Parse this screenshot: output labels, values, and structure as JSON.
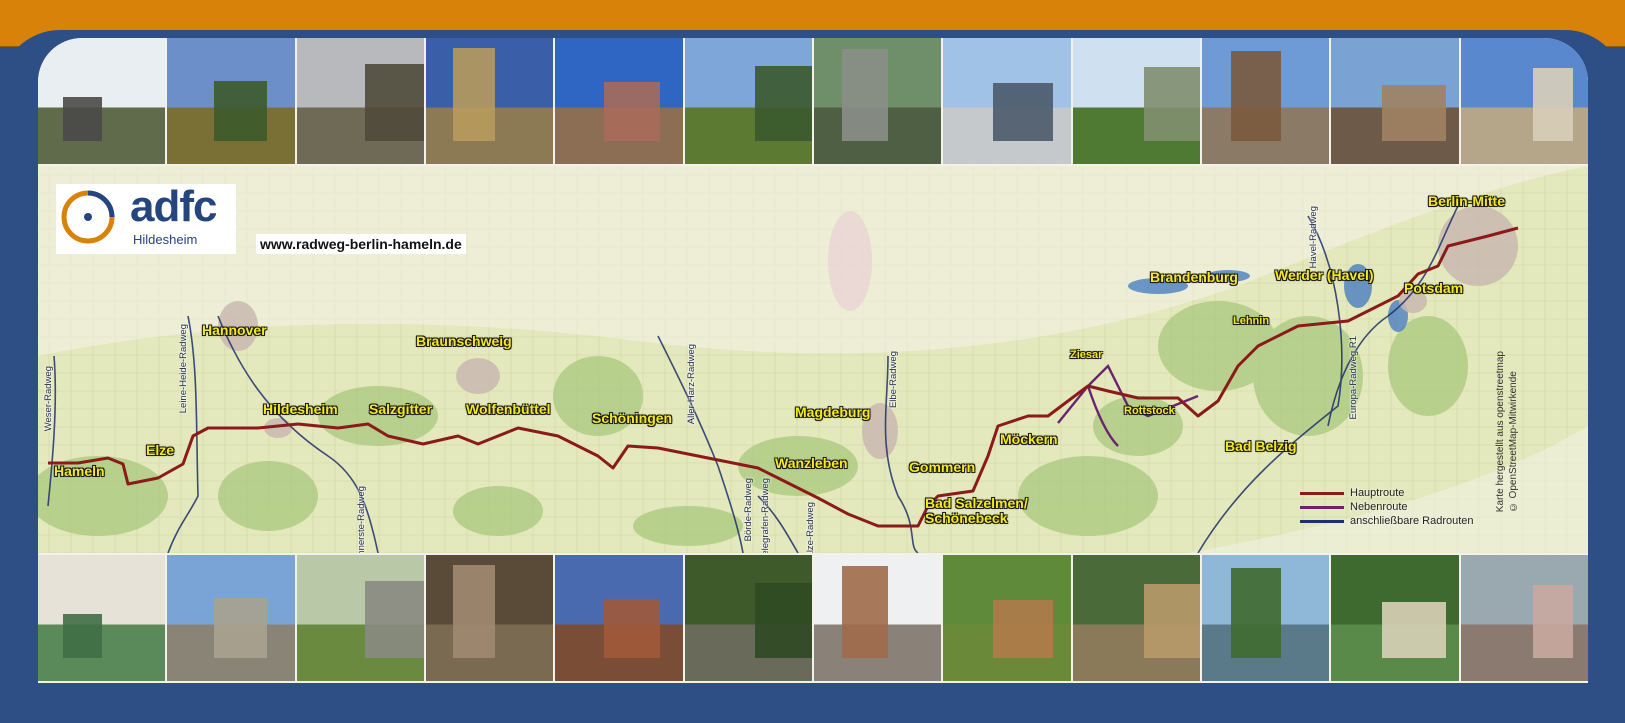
{
  "colors": {
    "frame_blue": "#2d4f86",
    "frame_orange": "#d98209",
    "main_route": "#8b1a1a",
    "side_route": "#6b2370",
    "connecting_route": "#1e2f6b",
    "label_yellow": "#f5ea1e"
  },
  "logo": {
    "wordmark": "adfc",
    "subtitle": "Hildesheim"
  },
  "website": "www.radweg-berlin-hameln.de",
  "places": {
    "hameln": "Hameln",
    "elze": "Elze",
    "hannover": "Hannover",
    "hildesheim": "Hildesheim",
    "salzgitter": "Salzgitter",
    "braunschweig": "Braunschweig",
    "wolfenbuettel": "Wolfenbüttel",
    "schoeningen": "Schöningen",
    "magdeburg": "Magdeburg",
    "wanzleben": "Wanzleben",
    "gommern": "Gommern",
    "bad_salzelmen": "Bad Salzelmen/\nSchönebeck",
    "moeckern": "Möckern",
    "ziesar": "Ziesar",
    "rottstock": "Rottstock",
    "bad_belzig": "Bad Belzig",
    "lehnin": "Lehnin",
    "brandenburg": "Brandenburg",
    "werder": "Werder (Havel)",
    "potsdam": "Potsdam",
    "berlin_mitte": "Berlin-Mitte"
  },
  "route_labels": {
    "weser": "Weser-Radweg",
    "leine_heide": "Leine-Heide-Radweg",
    "innerste": "Innerste-Radweg",
    "aller_harz": "Aller-Harz-Radweg",
    "boerde": "Börde-Radweg",
    "telegrafen": "Telegrafen-Radweg",
    "saelze": "Sälze-Radweg",
    "elbe": "Elbe-Radweg",
    "havel": "Havel-Radweg",
    "europa_r1": "Europa-Radweg R1"
  },
  "legend": [
    {
      "label": "Hauptroute",
      "color": "#8b1a1a"
    },
    {
      "label": "Nebenroute",
      "color": "#6b2370"
    },
    {
      "label": "anschließbare Radrouten",
      "color": "#1e2f6b"
    }
  ],
  "credit": "Karte hergestellt aus openstreetmap\n© OpenStreetMap-Mitwirkende",
  "photos_top": [
    {
      "sky": "#e8eef2",
      "ground": "#5f6b4a",
      "subject": "#4a4a48"
    },
    {
      "sky": "#6c8fc9",
      "ground": "#7a7035",
      "subject": "#3c5a2a"
    },
    {
      "sky": "#b8b9bc",
      "ground": "#6e6a55",
      "subject": "#4f4a3a"
    },
    {
      "sky": "#3a5ea8",
      "ground": "#8c7a55",
      "subject": "#b79a5c"
    },
    {
      "sky": "#2f66c4",
      "ground": "#8c6e55",
      "subject": "#a86a5a"
    },
    {
      "sky": "#7ea6d8",
      "ground": "#5d7a33",
      "subject": "#3b5a2d"
    },
    {
      "sky": "#6f8f6a",
      "ground": "#4f5f44",
      "subject": "#8a8f88"
    },
    {
      "sky": "#9fc2e6",
      "ground": "#c6c9cb",
      "subject": "#4a5a6a"
    },
    {
      "sky": "#cfe0f0",
      "ground": "#4f7a33",
      "subject": "#7f8f6f"
    },
    {
      "sky": "#6e9ad6",
      "ground": "#8a7a66",
      "subject": "#7a5a3d"
    },
    {
      "sky": "#7aa3d4",
      "ground": "#6e5a48",
      "subject": "#a08262"
    },
    {
      "sky": "#5a88cf",
      "ground": "#b5a68a",
      "subject": "#d8cfb8"
    }
  ],
  "photos_bottom": [
    {
      "sky": "#e6e2d8",
      "ground": "#5a8a5a",
      "subject": "#3f6e46"
    },
    {
      "sky": "#7aa4d6",
      "ground": "#8a8476",
      "subject": "#a8a290"
    },
    {
      "sky": "#b9c9a8",
      "ground": "#6a8a3f",
      "subject": "#8a8a82"
    },
    {
      "sky": "#5a4a38",
      "ground": "#7a6a52",
      "subject": "#a08a70"
    },
    {
      "sky": "#4a6ab0",
      "ground": "#7a4e36",
      "subject": "#a05a3a"
    },
    {
      "sky": "#3f5a2a",
      "ground": "#6a6a5a",
      "subject": "#2f4a22"
    },
    {
      "sky": "#eef0f2",
      "ground": "#8a8278",
      "subject": "#a06a4a"
    },
    {
      "sky": "#5f8a3a",
      "ground": "#6a8a3a",
      "subject": "#b07a4a"
    },
    {
      "sky": "#4a6a3a",
      "ground": "#8a7a5a",
      "subject": "#b89a6a"
    },
    {
      "sky": "#8fb8d8",
      "ground": "#5a7a8a",
      "subject": "#3f6a2f"
    },
    {
      "sky": "#3f6a2f",
      "ground": "#5a8a4a",
      "subject": "#d8d0b8"
    },
    {
      "sky": "#9aa8b0",
      "ground": "#8a7a70",
      "subject": "#c8a8a0"
    }
  ]
}
